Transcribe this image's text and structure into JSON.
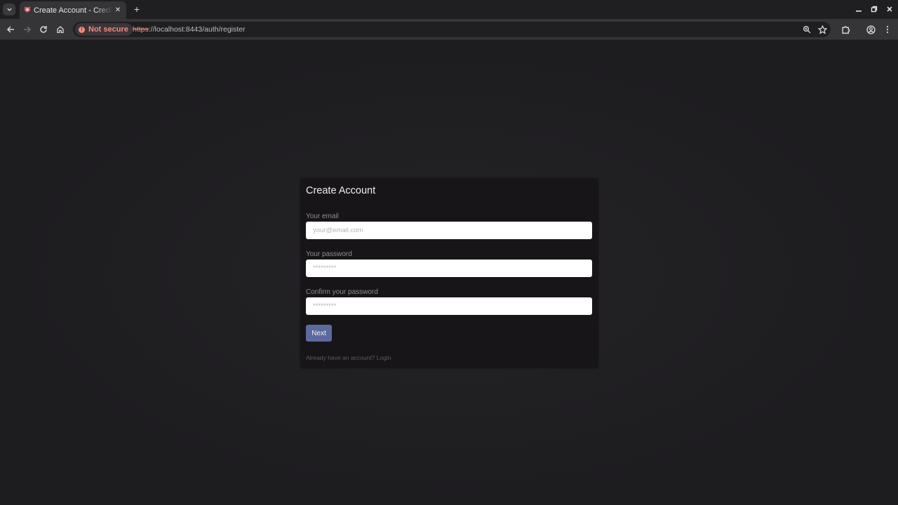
{
  "browser": {
    "tab": {
      "title": "Create Account - Credi",
      "close_glyph": "✕"
    },
    "new_tab_glyph": "+",
    "window_controls": {
      "minimize": "–",
      "restore": "❐",
      "close": "✕"
    },
    "security_chip": "Not secure",
    "url": {
      "scheme": "https",
      "rest": "://localhost:8443/auth/register"
    },
    "icons": [
      "tab-search-icon",
      "back-icon",
      "forward-icon",
      "reload-icon",
      "home-icon",
      "zoom-icon",
      "star-icon",
      "extensions-icon",
      "profile-icon",
      "menu-icon"
    ]
  },
  "form": {
    "title": "Create Account",
    "email": {
      "label": "Your email",
      "placeholder": "your@email.com"
    },
    "password": {
      "label": "Your password",
      "placeholder": "*********"
    },
    "confirm": {
      "label": "Confirm your password",
      "placeholder": "*********"
    },
    "submit_label": "Next",
    "login_prompt": "Already have an account?",
    "login_link": "Login"
  },
  "colors": {
    "page_background": "#1e1d20",
    "card_background": "#181518",
    "accent": "#5c6a9e",
    "warning": "#f28b82"
  }
}
